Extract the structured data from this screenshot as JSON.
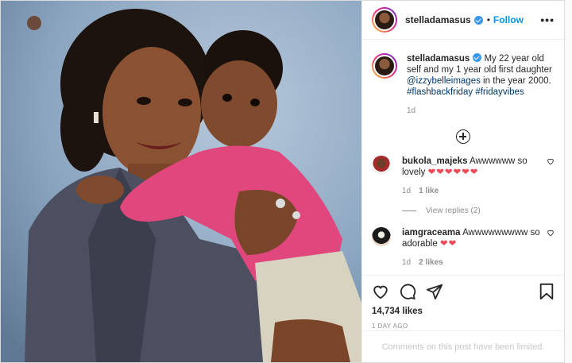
{
  "post": {
    "username": "stelladamasus",
    "follow_label": "Follow",
    "dot": "•",
    "more_label": "•••"
  },
  "caption": {
    "username": "stelladamasus",
    "text": " My 22 year old self and my 1 year old first daughter ",
    "mention": "@izzybelleimages",
    "text2": " in the year 2000. ",
    "hashtag1": "#flashbackfriday",
    "hashtag2": "#fridayvibes",
    "time": "1d"
  },
  "comments": [
    {
      "username": "bukola_majeks",
      "text": " Awwwwww so lovely ",
      "hearts": "❤❤❤❤❤❤",
      "time": "1d",
      "likes": "1 like",
      "view_replies": "View replies (2)"
    },
    {
      "username": "iamgraceama",
      "text": " Awwwwwwwww so adorable ",
      "hearts": "❤❤",
      "time": "1d",
      "likes": "2 likes"
    }
  ],
  "actions": {
    "likes": "14,734 likes",
    "date": "1 DAY AGO",
    "limited_notice": "Comments on this post have been limited."
  },
  "colors": {
    "accent": "#0095f6",
    "heart": "#ed4956",
    "muted": "#8e8e8e"
  },
  "icons": [
    "verified-badge-icon",
    "more-options-icon",
    "add-comment-icon",
    "heart-icon",
    "comment-icon",
    "share-icon",
    "bookmark-icon"
  ]
}
